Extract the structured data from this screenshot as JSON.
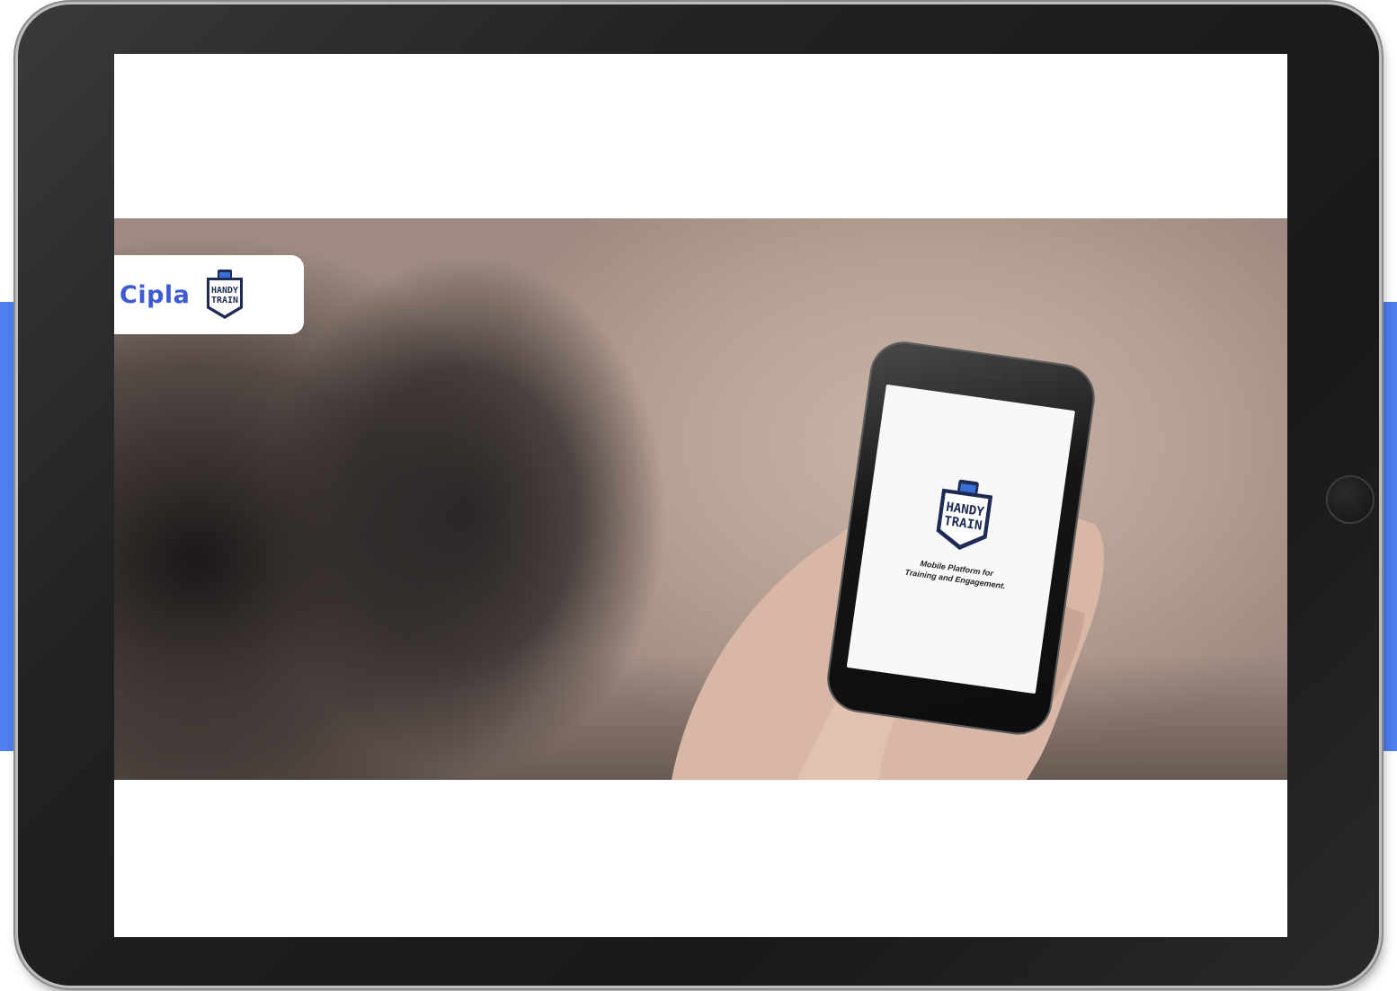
{
  "brand": {
    "company": "Cipla",
    "app_line1": "HANDY",
    "app_line2": "TRAIN",
    "tagline_line1": "Mobile Platform for",
    "tagline_line2": "Training and Engagement."
  },
  "colors": {
    "accent_blue": "#4f7ff0",
    "cipla_blue": "#3e5bd6",
    "badge_blue": "#3a6fd8",
    "badge_dark": "#1d2b55"
  },
  "icons": {
    "badge": "handy-train-badge-icon",
    "home": "home-button"
  }
}
